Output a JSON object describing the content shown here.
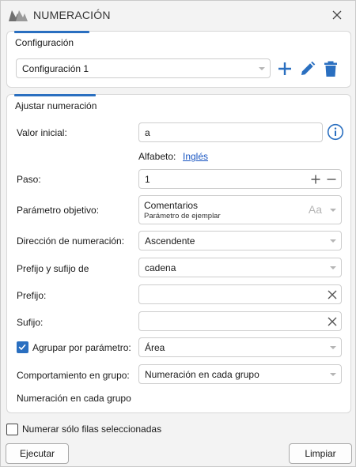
{
  "window": {
    "title": "NUMERACIÓN",
    "accent_color": "#2a6fc0",
    "logo_icon": "app-logo-icon",
    "close_icon": "close-icon"
  },
  "config": {
    "section_title": "Configuración",
    "selected": "Configuración 1",
    "add_icon": "plus-icon",
    "edit_icon": "pencil-icon",
    "delete_icon": "trash-icon"
  },
  "numbering": {
    "section_title": "Ajustar numeración",
    "initial_value": {
      "label": "Valor inicial:",
      "value": "a",
      "info_icon": "info-icon"
    },
    "alphabet": {
      "label": "Alfabeto:",
      "link": "Inglés"
    },
    "step": {
      "label": "Paso:",
      "value": "1"
    },
    "target_param": {
      "label": "Parámetro objetivo:",
      "value": "Comentarios",
      "sub": "Parámetro de ejemplar",
      "type_badge": "Aa"
    },
    "direction": {
      "label": "Dirección de numeración:",
      "value": "Ascendente"
    },
    "prefix_suffix_of": {
      "label": "Prefijo y sufijo de",
      "value": "cadena"
    },
    "prefix": {
      "label": "Prefijo:",
      "value": ""
    },
    "suffix": {
      "label": "Sufijo:",
      "value": ""
    },
    "group_by": {
      "label": "Agrupar por parámetro:",
      "checked": true,
      "value": "Área"
    },
    "group_behavior": {
      "label": "Comportamiento en grupo:",
      "value": "Numeración en cada grupo"
    },
    "group_note": "Numeración en cada grupo"
  },
  "footer": {
    "only_selected": {
      "label": "Numerar sólo filas seleccionadas",
      "checked": false
    },
    "run_label": "Ejecutar",
    "clear_label": "Limpiar"
  }
}
